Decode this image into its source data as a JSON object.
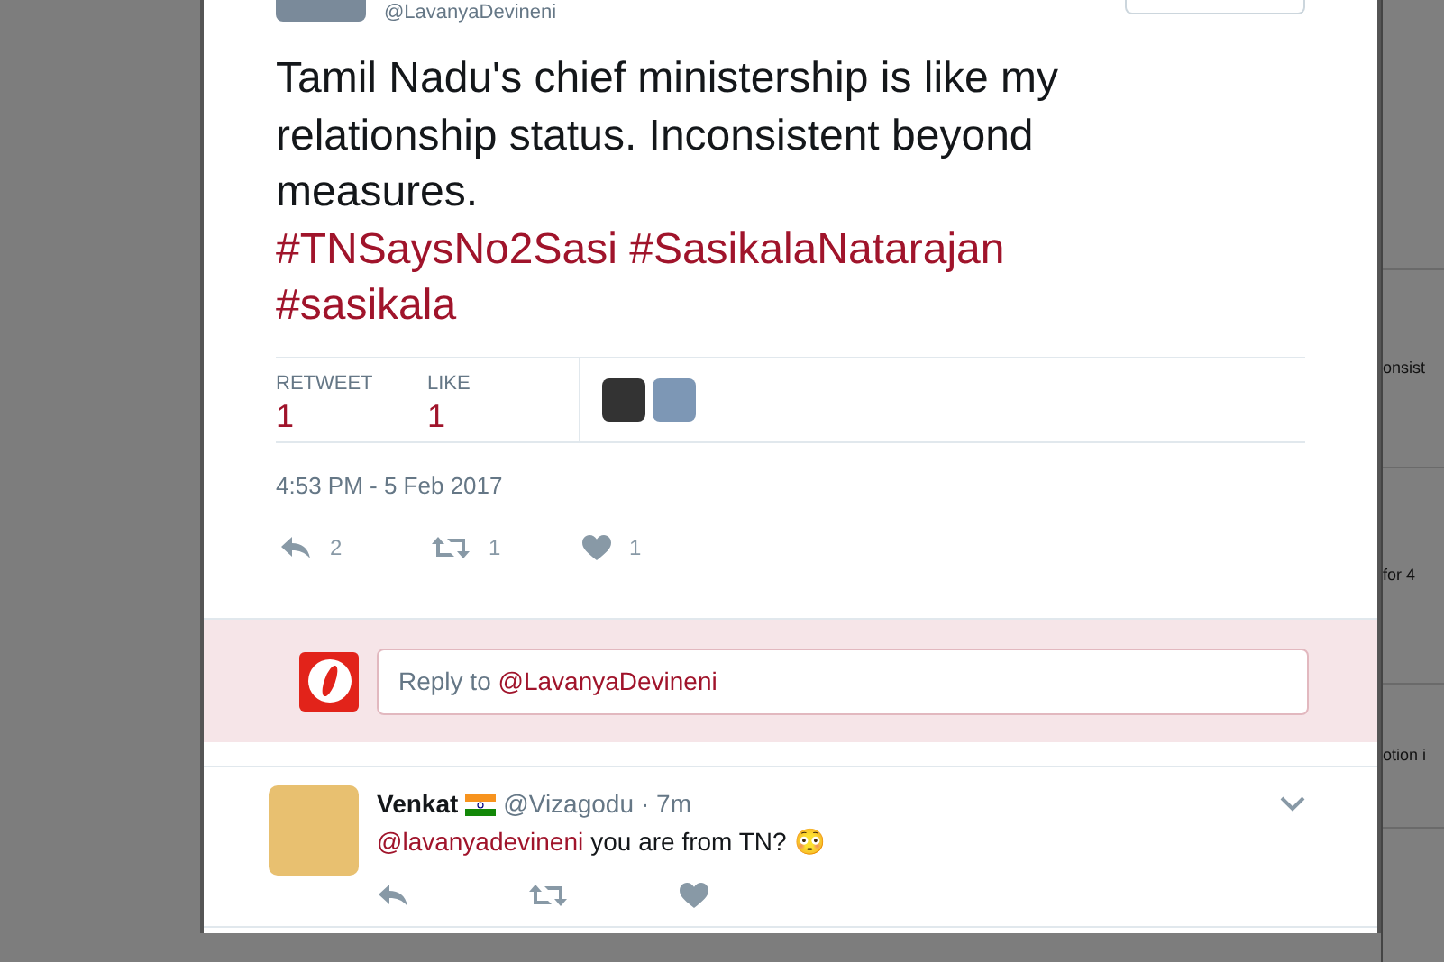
{
  "tweet": {
    "handle": "@LavanyaDevineni",
    "text": "Tamil Nadu's chief ministership is like my relationship status. Inconsistent beyond measures.",
    "hashtags": [
      "#TNSaysNo2Sasi",
      "#SasikalaNatarajan",
      "#sasikala"
    ],
    "stats": [
      {
        "label": "RETWEET",
        "value": "1"
      },
      {
        "label": "LIKE",
        "value": "1"
      }
    ],
    "timestamp": "4:53 PM - 5 Feb 2017",
    "actions": [
      {
        "kind": "reply",
        "count": "2"
      },
      {
        "kind": "retweet",
        "count": "1"
      },
      {
        "kind": "like",
        "count": "1"
      }
    ]
  },
  "reply_box": {
    "prefix": "Reply to",
    "mention": "@LavanyaDevineni"
  },
  "replies": [
    {
      "name": "Venkat",
      "handle": "@Vizagodu",
      "time": "· 7m",
      "mention": "@lavanyadevineni",
      "text": "you are from TN?",
      "emoji": "😳",
      "actions": [
        {
          "kind": "reply"
        },
        {
          "kind": "retweet"
        },
        {
          "kind": "like"
        }
      ]
    }
  ],
  "background_texts": [
    "onsist",
    "for 4",
    "otion i"
  ]
}
